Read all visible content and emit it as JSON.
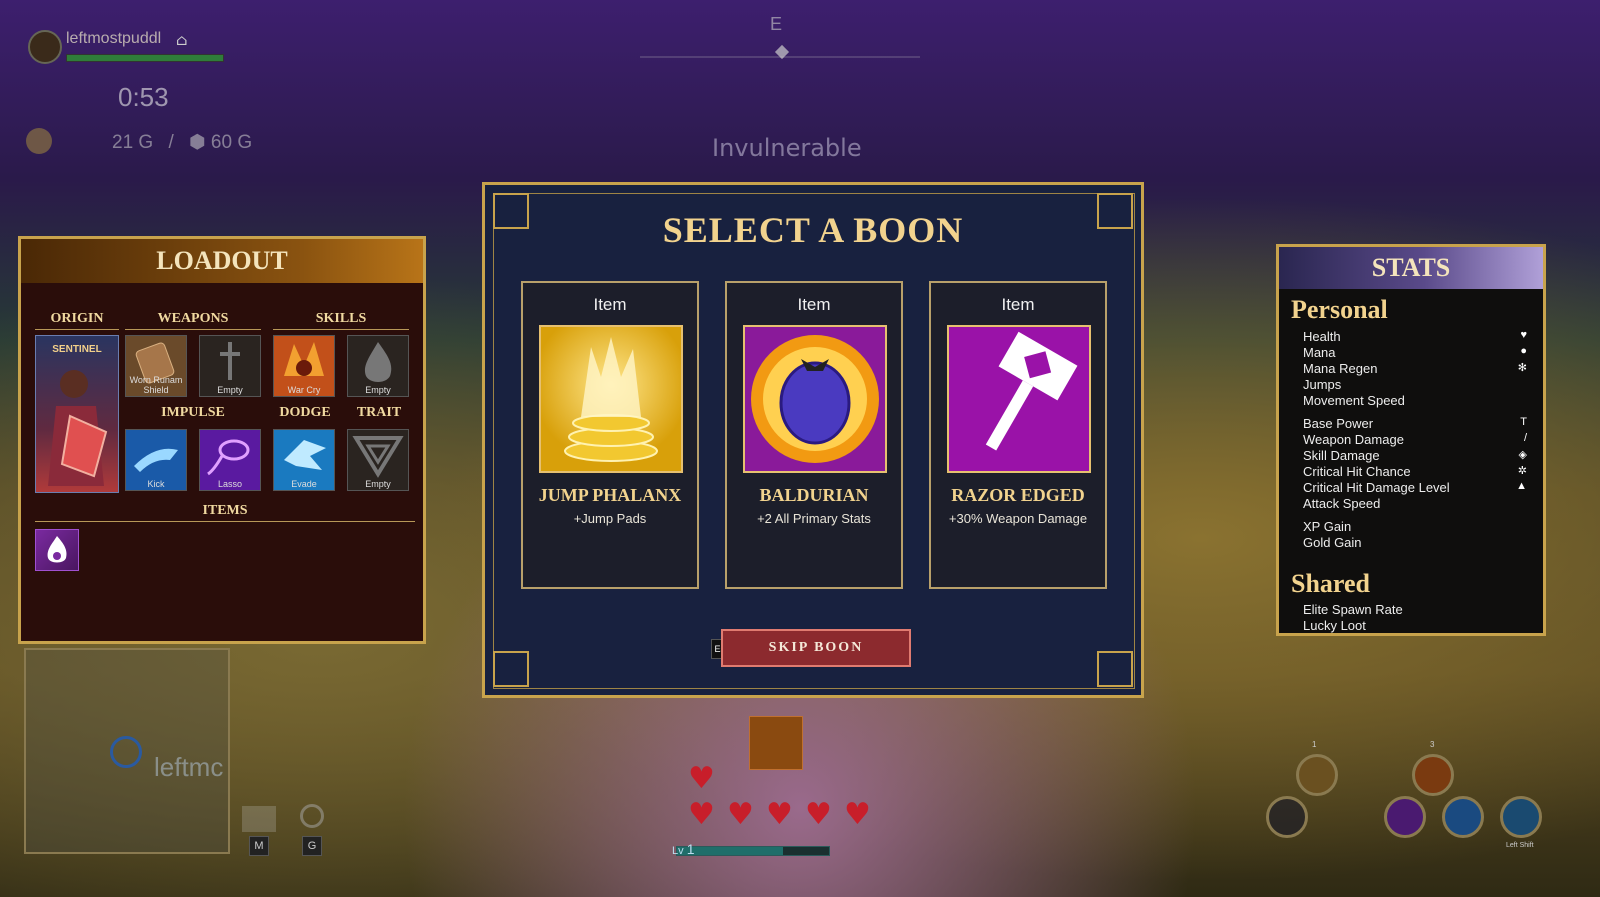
{
  "hud": {
    "player_name": "leftmostpuddl",
    "health_fraction": 1.0,
    "timer": "0:53",
    "gold": "21 G",
    "separator": "/",
    "gold_cost": "60 G",
    "compass_heading": "E",
    "status_text": "Invulnerable"
  },
  "loadout": {
    "title": "LOADOUT",
    "sections": {
      "origin": "ORIGIN",
      "weapons": "WEAPONS",
      "skills": "SKILLS",
      "impulse": "IMPULSE",
      "dodge": "DODGE",
      "trait": "TRAIT",
      "items": "ITEMS"
    },
    "origin_name": "SENTINEL",
    "weapons": [
      {
        "label": "Worn Runam Shield",
        "icon": "shield-icon",
        "color": "#7a5a3a"
      },
      {
        "label": "Empty",
        "icon": "sword-icon",
        "color": "#3a3a3a"
      }
    ],
    "skills": [
      {
        "label": "War Cry",
        "icon": "war-cry-icon",
        "color": "#d86a18"
      },
      {
        "label": "Empty",
        "icon": "flame-icon",
        "color": "#3a3a3a"
      }
    ],
    "impulse": [
      {
        "label": "Kick",
        "icon": "kick-icon",
        "color": "#2a7ac8"
      },
      {
        "label": "Lasso",
        "icon": "lasso-icon",
        "color": "#8a3ad0"
      }
    ],
    "dodge": {
      "label": "Evade",
      "icon": "evade-icon",
      "color": "#2a9ad8"
    },
    "trait": {
      "label": "Empty",
      "icon": "trait-icon",
      "color": "#3a3a3a"
    }
  },
  "boon": {
    "title": "SELECT A BOON",
    "cards": [
      {
        "type": "Item",
        "name": "JUMP PHALANX",
        "desc": "+Jump Pads",
        "icon": "jump-pad-icon"
      },
      {
        "type": "Item",
        "name": "BALDURIAN",
        "desc": "+2 All Primary Stats",
        "icon": "berry-icon"
      },
      {
        "type": "Item",
        "name": "RAZOR EDGED",
        "desc": "+30% Weapon Damage",
        "icon": "hammer-icon"
      }
    ],
    "skip_label": "SKIP BOON",
    "skip_key": "Esc"
  },
  "stats": {
    "title": "STATS",
    "personal_heading": "Personal",
    "personal_group1": [
      "Health",
      "Mana",
      "Mana Regen",
      "Jumps",
      "Movement Speed"
    ],
    "personal_group2": [
      "Base Power",
      "Weapon Damage",
      "Skill Damage",
      "Critical Hit Chance",
      "Critical Hit Damage Level",
      "Attack Speed"
    ],
    "personal_group3": [
      "XP Gain",
      "Gold Gain"
    ],
    "shared_heading": "Shared",
    "shared": [
      "Elite Spawn Rate",
      "Lucky Loot"
    ]
  },
  "minimap": {
    "player_label": "leftmc",
    "map_key": "M",
    "search_key": "G"
  },
  "bottom": {
    "level_label": "Lv",
    "level": "1",
    "hearts": 6
  },
  "abilities": {
    "slot1_key": "1",
    "slot3_key": "3",
    "dodge_key": "Left Shift"
  }
}
